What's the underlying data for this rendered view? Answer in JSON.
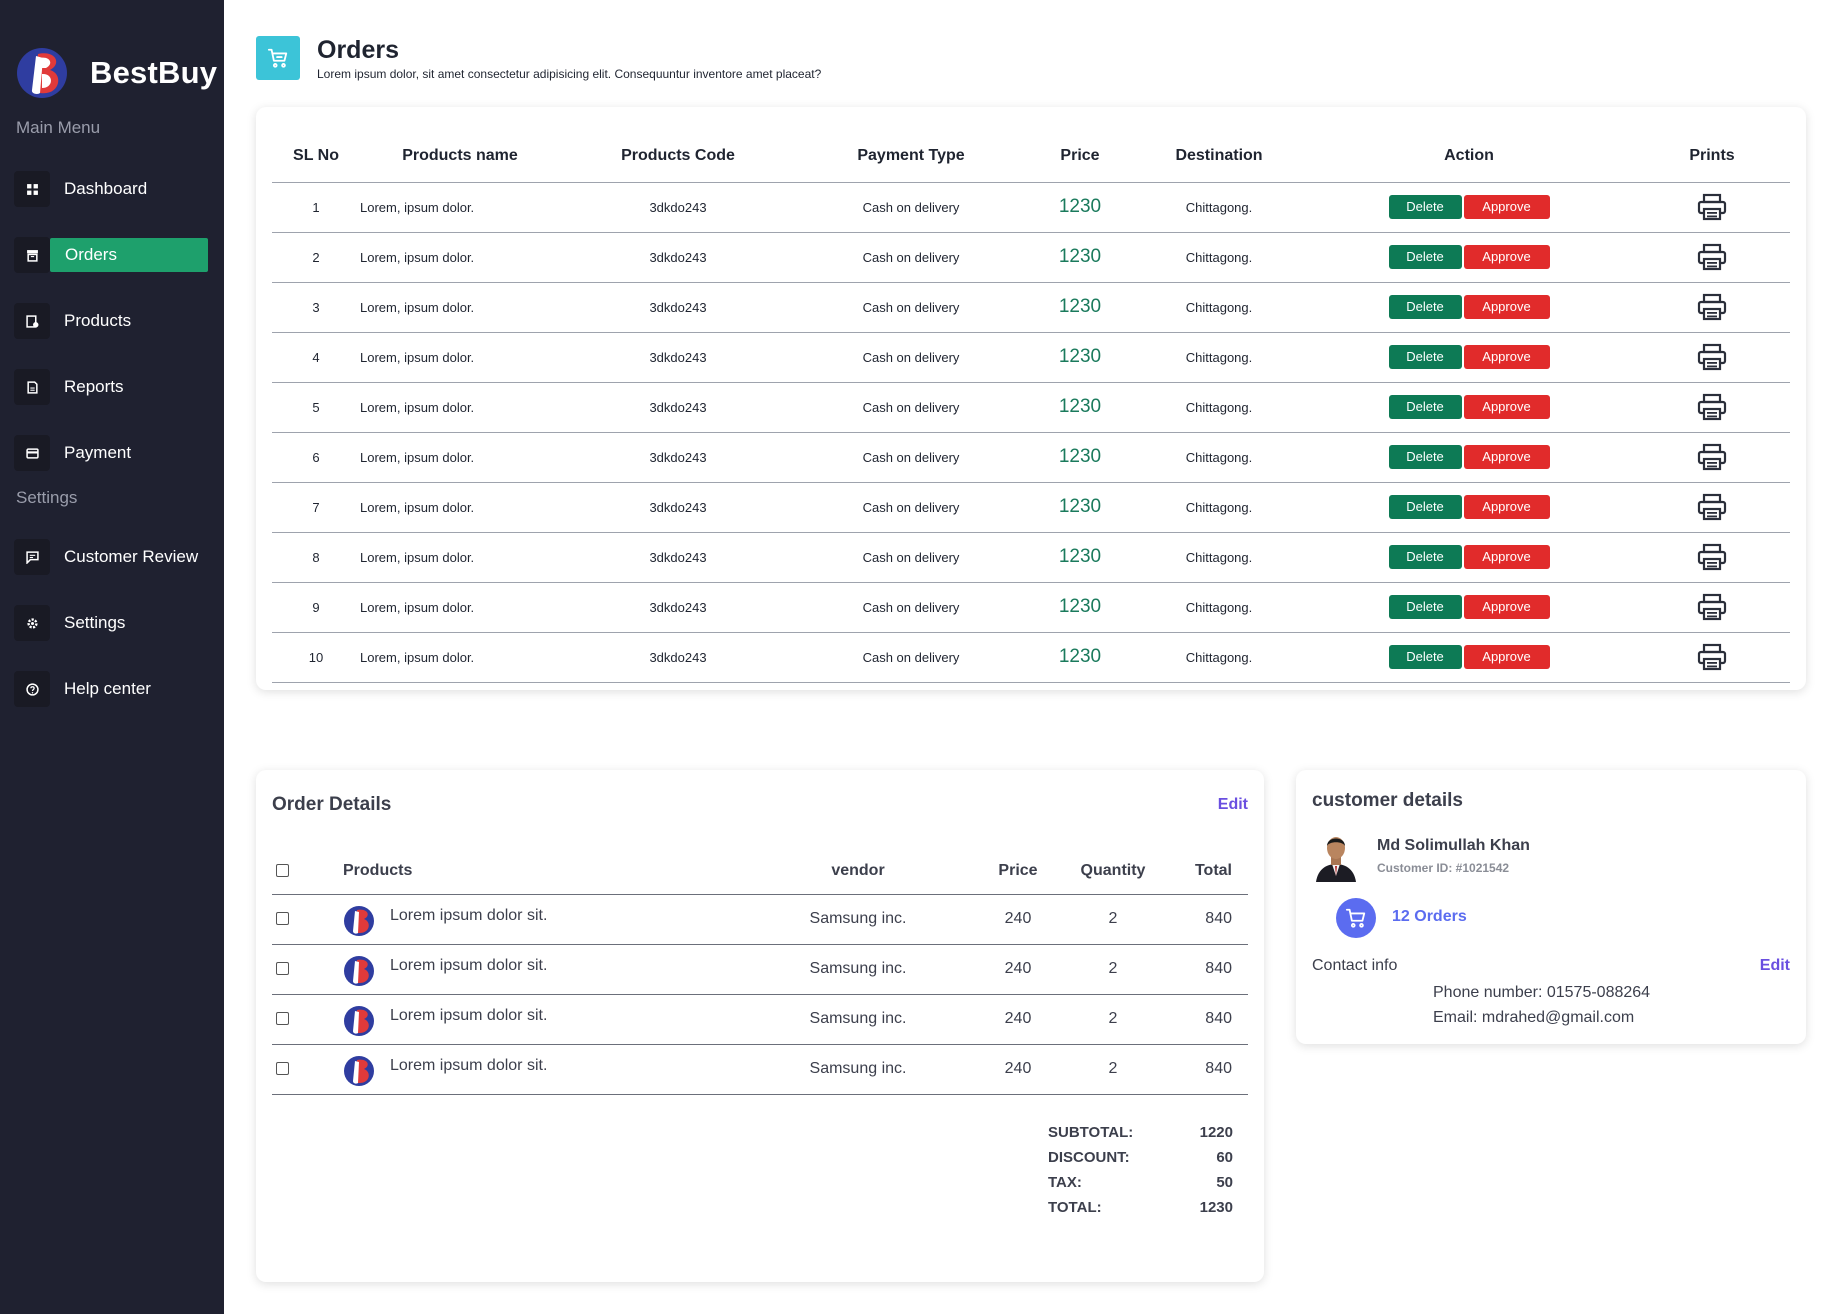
{
  "sidebar": {
    "brand": "BestBuy",
    "main_menu_label": "Main Menu",
    "settings_label": "Settings",
    "items": [
      {
        "label": "Dashboard",
        "icon": "dashboard-icon"
      },
      {
        "label": "Orders",
        "icon": "orders-icon",
        "active": true
      },
      {
        "label": "Products",
        "icon": "products-icon"
      },
      {
        "label": "Reports",
        "icon": "reports-icon"
      },
      {
        "label": "Payment",
        "icon": "payment-icon"
      }
    ],
    "settings_items": [
      {
        "label": "Customer Review",
        "icon": "review-icon"
      },
      {
        "label": "Settings",
        "icon": "gear-icon"
      },
      {
        "label": "Help center",
        "icon": "help-icon"
      }
    ]
  },
  "header": {
    "title": "Orders",
    "subtitle": "Lorem ipsum dolor, sit amet consectetur adipisicing elit. Consequuntur inventore amet placeat?"
  },
  "orders": {
    "columns": [
      "SL No",
      "Products name",
      "Products Code",
      "Payment Type",
      "Price",
      "Destination",
      "Action",
      "Prints"
    ],
    "delete_label": "Delete",
    "approve_label": "Approve",
    "rows": [
      {
        "sl": "1",
        "name": "Lorem, ipsum dolor.",
        "code": "3dkdo243",
        "payment": "Cash on delivery",
        "price": "1230",
        "destination": "Chittagong."
      },
      {
        "sl": "2",
        "name": "Lorem, ipsum dolor.",
        "code": "3dkdo243",
        "payment": "Cash on delivery",
        "price": "1230",
        "destination": "Chittagong."
      },
      {
        "sl": "3",
        "name": "Lorem, ipsum dolor.",
        "code": "3dkdo243",
        "payment": "Cash on delivery",
        "price": "1230",
        "destination": "Chittagong."
      },
      {
        "sl": "4",
        "name": "Lorem, ipsum dolor.",
        "code": "3dkdo243",
        "payment": "Cash on delivery",
        "price": "1230",
        "destination": "Chittagong."
      },
      {
        "sl": "5",
        "name": "Lorem, ipsum dolor.",
        "code": "3dkdo243",
        "payment": "Cash on delivery",
        "price": "1230",
        "destination": "Chittagong."
      },
      {
        "sl": "6",
        "name": "Lorem, ipsum dolor.",
        "code": "3dkdo243",
        "payment": "Cash on delivery",
        "price": "1230",
        "destination": "Chittagong."
      },
      {
        "sl": "7",
        "name": "Lorem, ipsum dolor.",
        "code": "3dkdo243",
        "payment": "Cash on delivery",
        "price": "1230",
        "destination": "Chittagong."
      },
      {
        "sl": "8",
        "name": "Lorem, ipsum dolor.",
        "code": "3dkdo243",
        "payment": "Cash on delivery",
        "price": "1230",
        "destination": "Chittagong."
      },
      {
        "sl": "9",
        "name": "Lorem, ipsum dolor.",
        "code": "3dkdo243",
        "payment": "Cash on delivery",
        "price": "1230",
        "destination": "Chittagong."
      },
      {
        "sl": "10",
        "name": "Lorem, ipsum dolor.",
        "code": "3dkdo243",
        "payment": "Cash on delivery",
        "price": "1230",
        "destination": "Chittagong."
      }
    ]
  },
  "order_details": {
    "title": "Order Details",
    "edit_label": "Edit",
    "columns": [
      "Products",
      "vendor",
      "Price",
      "Quantity",
      "Total"
    ],
    "rows": [
      {
        "product": "Lorem ipsum dolor sit.",
        "vendor": "Samsung inc.",
        "price": "240",
        "quantity": "2",
        "total": "840"
      },
      {
        "product": "Lorem ipsum dolor sit.",
        "vendor": "Samsung inc.",
        "price": "240",
        "quantity": "2",
        "total": "840"
      },
      {
        "product": "Lorem ipsum dolor sit.",
        "vendor": "Samsung inc.",
        "price": "240",
        "quantity": "2",
        "total": "840"
      },
      {
        "product": "Lorem ipsum dolor sit.",
        "vendor": "Samsung inc.",
        "price": "240",
        "quantity": "2",
        "total": "840"
      }
    ],
    "summary": [
      {
        "label": "SUBTOTAL:",
        "value": "1220"
      },
      {
        "label": "DISCOUNT:",
        "value": "60"
      },
      {
        "label": "TAX:",
        "value": "50"
      },
      {
        "label": "TOTAL:",
        "value": "1230"
      }
    ]
  },
  "customer": {
    "title": "customer details",
    "name": "Md Solimullah Khan",
    "customer_id": "Customer ID: #1021542",
    "orders_count": "12 Orders",
    "contact_label": "Contact info",
    "edit_label": "Edit",
    "phone": "Phone number: 01575-088264",
    "email": "Email: mdrahed@gmail.com"
  },
  "colors": {
    "sidebar_bg": "#1f2130",
    "active_green": "#1ea06c",
    "header_icon_bg": "#3cc4d8",
    "price_green": "#1a7a5c",
    "delete_green": "#0d7a55",
    "approve_red": "#e12b2b",
    "edit_purple": "#6a4fe0",
    "orders_blue": "#5b6cf0"
  }
}
